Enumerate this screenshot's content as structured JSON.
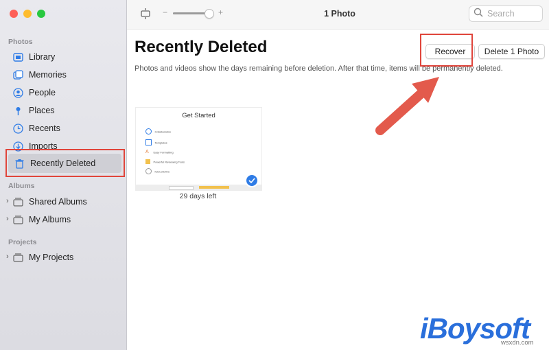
{
  "sidebar": {
    "sections": {
      "photos": "Photos",
      "albums": "Albums",
      "projects": "Projects"
    },
    "items": [
      {
        "label": "Library",
        "icon": "library-icon"
      },
      {
        "label": "Memories",
        "icon": "memories-icon"
      },
      {
        "label": "People",
        "icon": "people-icon"
      },
      {
        "label": "Places",
        "icon": "places-icon"
      },
      {
        "label": "Recents",
        "icon": "recents-icon"
      },
      {
        "label": "Imports",
        "icon": "imports-icon"
      },
      {
        "label": "Recently Deleted",
        "icon": "trash-icon",
        "selected": true
      }
    ],
    "albums": [
      {
        "label": "Shared Albums"
      },
      {
        "label": "My Albums"
      }
    ],
    "projects": [
      {
        "label": "My Projects"
      }
    ]
  },
  "toolbar": {
    "title": "1 Photo",
    "zoom_minus": "−",
    "zoom_plus": "+",
    "search_placeholder": "Search"
  },
  "main": {
    "title": "Recently Deleted",
    "description": "Photos and videos show the days remaining before deletion. After that time, items will be permanently deleted.",
    "recover_label": "Recover",
    "delete_label": "Delete 1 Photo",
    "photo": {
      "doc_title": "Get Started",
      "days_left": "29 days left",
      "rows": [
        "Collaboration",
        "Templates",
        "Easy Formatting",
        "Powerful Reviewing Tools",
        "iCloud Drive"
      ]
    }
  },
  "watermark": {
    "brand": "iBoysoft",
    "site": "wsxdn.com"
  },
  "colors": {
    "highlight": "#e0453b",
    "accent": "#2f7ce6",
    "arrow": "#e35a4c"
  }
}
